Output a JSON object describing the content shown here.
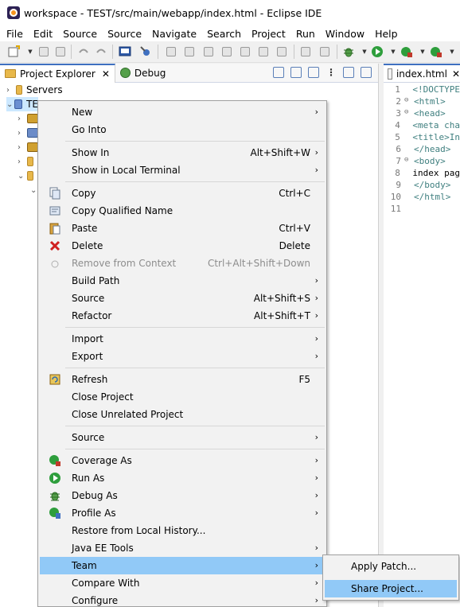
{
  "window": {
    "title": "workspace - TEST/src/main/webapp/index.html - Eclipse IDE"
  },
  "menubar": [
    "File",
    "Edit",
    "Source",
    "Source",
    "Navigate",
    "Search",
    "Project",
    "Run",
    "Window",
    "Help"
  ],
  "views": {
    "project_explorer_tab": "Project Explorer",
    "debug_tab": "Debug",
    "editor_tab": "index.html"
  },
  "tree": {
    "servers": "Servers",
    "project": "TE"
  },
  "editor": {
    "lines": [
      {
        "n": "1",
        "fold": "",
        "text": "<!DOCTYPE",
        "plain": false
      },
      {
        "n": "2",
        "fold": "⊖",
        "text": "<html>",
        "plain": false
      },
      {
        "n": "3",
        "fold": "⊖",
        "text": "<head>",
        "plain": false
      },
      {
        "n": "4",
        "fold": "",
        "text": "<meta cha",
        "plain": false
      },
      {
        "n": "5",
        "fold": "",
        "text": "<title>In",
        "plain": false
      },
      {
        "n": "6",
        "fold": "",
        "text": "</head>",
        "plain": false
      },
      {
        "n": "7",
        "fold": "⊖",
        "text": "<body>",
        "plain": false
      },
      {
        "n": "8",
        "fold": "",
        "text": "index pag",
        "plain": true
      },
      {
        "n": "9",
        "fold": "",
        "text": "</body>",
        "plain": false
      },
      {
        "n": "10",
        "fold": "",
        "text": "</html>",
        "plain": false
      },
      {
        "n": "11",
        "fold": "",
        "text": "",
        "plain": true
      }
    ]
  },
  "context_menu": {
    "new": "New",
    "go_into": "Go Into",
    "show_in": "Show In",
    "show_in_acc": "Alt+Shift+W",
    "show_in_terminal": "Show in Local Terminal",
    "copy": "Copy",
    "copy_acc": "Ctrl+C",
    "copy_qualified": "Copy Qualified Name",
    "paste": "Paste",
    "paste_acc": "Ctrl+V",
    "delete": "Delete",
    "delete_acc": "Delete",
    "remove_context": "Remove from Context",
    "remove_context_acc": "Ctrl+Alt+Shift+Down",
    "build_path": "Build Path",
    "source": "Source",
    "source_acc": "Alt+Shift+S",
    "refactor": "Refactor",
    "refactor_acc": "Alt+Shift+T",
    "import": "Import",
    "export": "Export",
    "refresh": "Refresh",
    "refresh_acc": "F5",
    "close_project": "Close Project",
    "close_unrelated": "Close Unrelated Project",
    "source2": "Source",
    "coverage_as": "Coverage As",
    "run_as": "Run As",
    "debug_as": "Debug As",
    "profile_as": "Profile As",
    "restore_history": "Restore from Local History...",
    "javaee_tools": "Java EE Tools",
    "team": "Team",
    "compare_with": "Compare With",
    "configure": "Configure"
  },
  "team_submenu": {
    "apply_patch": "Apply Patch...",
    "share_project": "Share Project..."
  },
  "colors": {
    "highlight": "#91c9f7",
    "menu_bg": "#f2f2f2",
    "tree_selection": "#cce8ff",
    "tag": "#3f7f7f"
  }
}
